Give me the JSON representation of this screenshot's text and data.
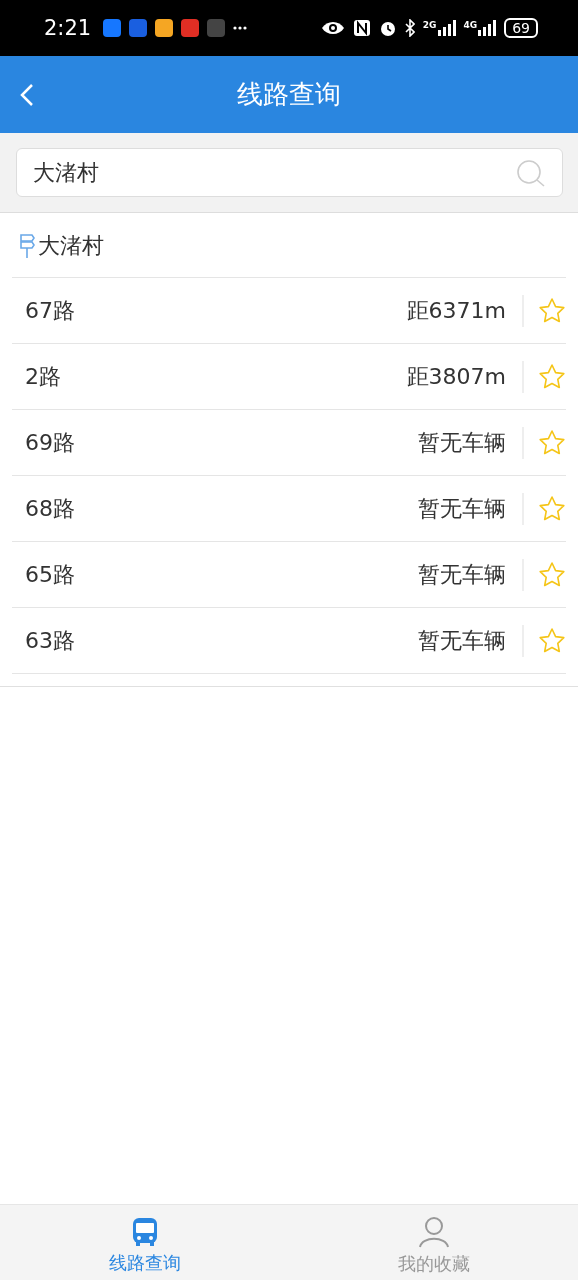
{
  "status_bar": {
    "time": "2:21",
    "network_labels": [
      "2G",
      "4G"
    ],
    "battery": "69"
  },
  "header": {
    "title": "线路查询"
  },
  "search": {
    "value": "大渚村"
  },
  "stop": {
    "name": "大渚村"
  },
  "routes": [
    {
      "name": "67路",
      "status": "距6371m",
      "favorited": false
    },
    {
      "name": "2路",
      "status": "距3807m",
      "favorited": false
    },
    {
      "name": "69路",
      "status": "暂无车辆",
      "favorited": false
    },
    {
      "name": "68路",
      "status": "暂无车辆",
      "favorited": false
    },
    {
      "name": "65路",
      "status": "暂无车辆",
      "favorited": false
    },
    {
      "name": "63路",
      "status": "暂无车辆",
      "favorited": false
    }
  ],
  "tabs": [
    {
      "label": "线路查询",
      "kind": "bus",
      "selected": true
    },
    {
      "label": "我的收藏",
      "kind": "person",
      "selected": false
    }
  ]
}
